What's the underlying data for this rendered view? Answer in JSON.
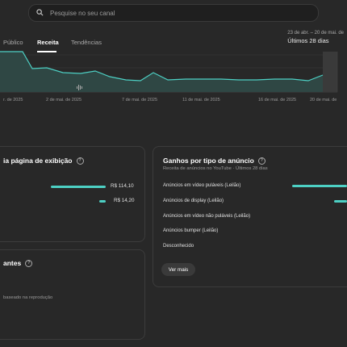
{
  "search": {
    "placeholder": "Pesquise no seu canal"
  },
  "tabs": [
    {
      "label": "Público"
    },
    {
      "label": "Receita"
    },
    {
      "label": "Tendências"
    }
  ],
  "date_range": {
    "dates": "23 de abr. – 20 de mai. de",
    "period": "Últimos 28 dias"
  },
  "chart": {
    "x_ticks": [
      "r. de 2025",
      "2 de mai. de 2025",
      "7 de mai. de 2025",
      "11 de mai. de 2025",
      "16 de mai. de 2025",
      "20 de mai. de"
    ]
  },
  "card_watch": {
    "title": "ia página de exibição",
    "rows": [
      {
        "value": "R$ 114,10",
        "fraction": 1.0
      },
      {
        "value": "R$ 14,20",
        "fraction": 0.12
      }
    ]
  },
  "card_members": {
    "title": "antes",
    "subtitle": "baseado na reprodução"
  },
  "card_ads": {
    "title": "Ganhos por tipo de anúncio",
    "subtitle": "Receita de anúncios no YouTube · Últimos 28 dias",
    "rows": [
      {
        "label": "Anúncios em vídeo puláveis (Leilão)"
      },
      {
        "label": "Anúncios de display (Leilão)"
      },
      {
        "label": "Anúncios em vídeo não puláveis (Leilão)"
      },
      {
        "label": "Anúncios bumper (Leilão)"
      },
      {
        "label": "Desconhecido"
      }
    ],
    "button_label": "Ver mais"
  },
  "colors": {
    "accent": "#4dd0c4",
    "background": "#282828"
  }
}
